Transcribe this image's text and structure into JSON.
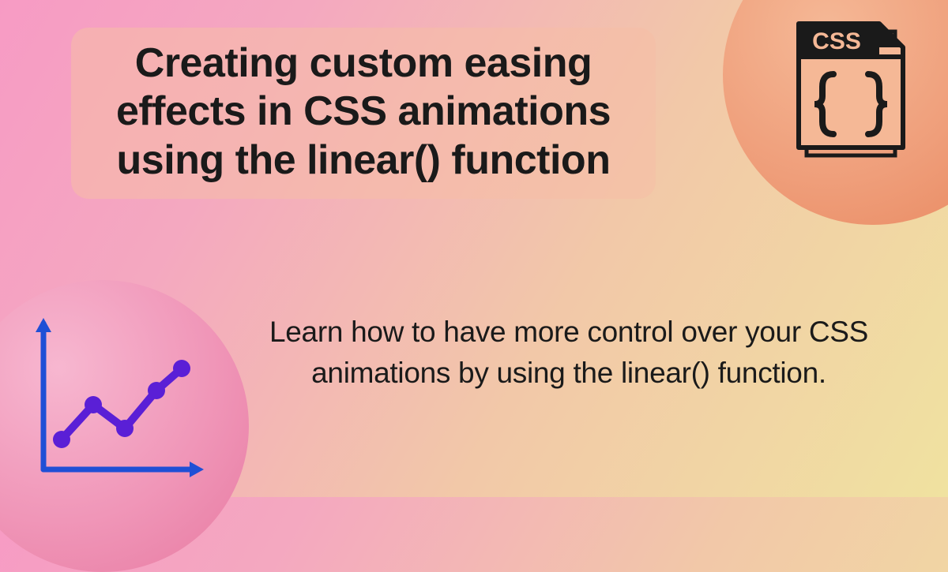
{
  "title": "Creating custom easing effects in CSS animations using the linear() function",
  "subtitle": "Learn how to have more control over your CSS animations by using the linear() function.",
  "cssLabel": "CSS"
}
